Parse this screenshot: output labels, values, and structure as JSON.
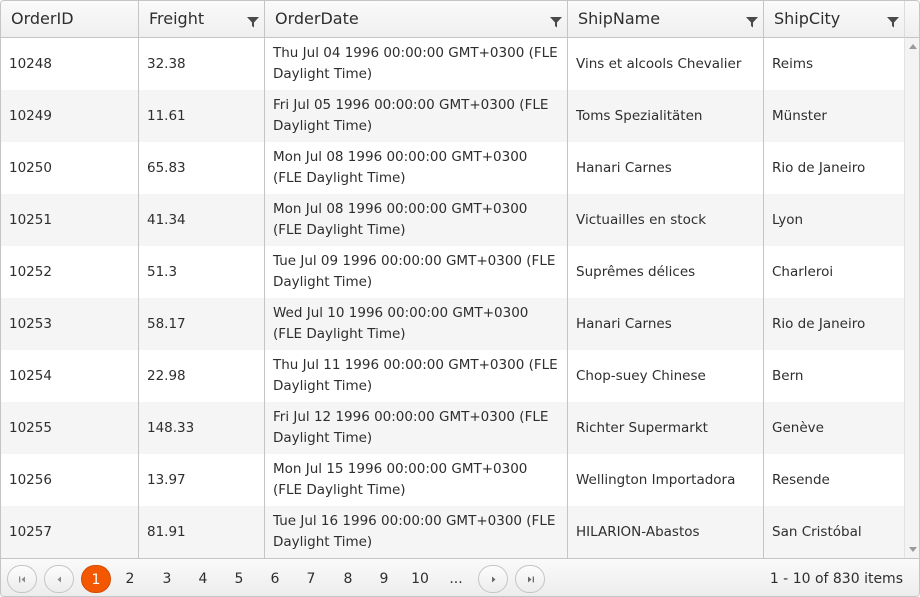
{
  "columns": [
    {
      "title": "OrderID",
      "filter": false
    },
    {
      "title": "Freight",
      "filter": true
    },
    {
      "title": "OrderDate",
      "filter": true
    },
    {
      "title": "ShipName",
      "filter": true
    },
    {
      "title": "ShipCity",
      "filter": true
    }
  ],
  "rows": [
    {
      "id": "10248",
      "freight": "32.38",
      "date": "Thu Jul 04 1996 00:00:00 GMT+0300 (FLE Daylight Time)",
      "ship": "Vins et alcools Chevalier",
      "city": "Reims"
    },
    {
      "id": "10249",
      "freight": "11.61",
      "date": "Fri Jul 05 1996 00:00:00 GMT+0300 (FLE Daylight Time)",
      "ship": "Toms Spezialitäten",
      "city": "Münster"
    },
    {
      "id": "10250",
      "freight": "65.83",
      "date": "Mon Jul 08 1996 00:00:00 GMT+0300 (FLE Daylight Time)",
      "ship": "Hanari Carnes",
      "city": "Rio de Janeiro"
    },
    {
      "id": "10251",
      "freight": "41.34",
      "date": "Mon Jul 08 1996 00:00:00 GMT+0300 (FLE Daylight Time)",
      "ship": "Victuailles en stock",
      "city": "Lyon"
    },
    {
      "id": "10252",
      "freight": "51.3",
      "date": "Tue Jul 09 1996 00:00:00 GMT+0300 (FLE Daylight Time)",
      "ship": "Suprêmes délices",
      "city": "Charleroi"
    },
    {
      "id": "10253",
      "freight": "58.17",
      "date": "Wed Jul 10 1996 00:00:00 GMT+0300 (FLE Daylight Time)",
      "ship": "Hanari Carnes",
      "city": "Rio de Janeiro"
    },
    {
      "id": "10254",
      "freight": "22.98",
      "date": "Thu Jul 11 1996 00:00:00 GMT+0300 (FLE Daylight Time)",
      "ship": "Chop-suey Chinese",
      "city": "Bern"
    },
    {
      "id": "10255",
      "freight": "148.33",
      "date": "Fri Jul 12 1996 00:00:00 GMT+0300 (FLE Daylight Time)",
      "ship": "Richter Supermarkt",
      "city": "Genève"
    },
    {
      "id": "10256",
      "freight": "13.97",
      "date": "Mon Jul 15 1996 00:00:00 GMT+0300 (FLE Daylight Time)",
      "ship": "Wellington Importadora",
      "city": "Resende"
    },
    {
      "id": "10257",
      "freight": "81.91",
      "date": "Tue Jul 16 1996 00:00:00 GMT+0300 (FLE Daylight Time)",
      "ship": "HILARION-Abastos",
      "city": "San Cristóbal"
    }
  ],
  "pager": {
    "pages": [
      "1",
      "2",
      "3",
      "4",
      "5",
      "6",
      "7",
      "8",
      "9",
      "10",
      "..."
    ],
    "current": "1",
    "info": "1 - 10 of 830 items",
    "nav_icons": [
      "first-page-icon",
      "previous-page-icon",
      "next-page-icon",
      "last-page-icon"
    ]
  },
  "colors": {
    "accent": "#f35800",
    "border": "#c5c5c5",
    "alt_row": "#f5f5f5",
    "text": "#2e2e2e"
  }
}
